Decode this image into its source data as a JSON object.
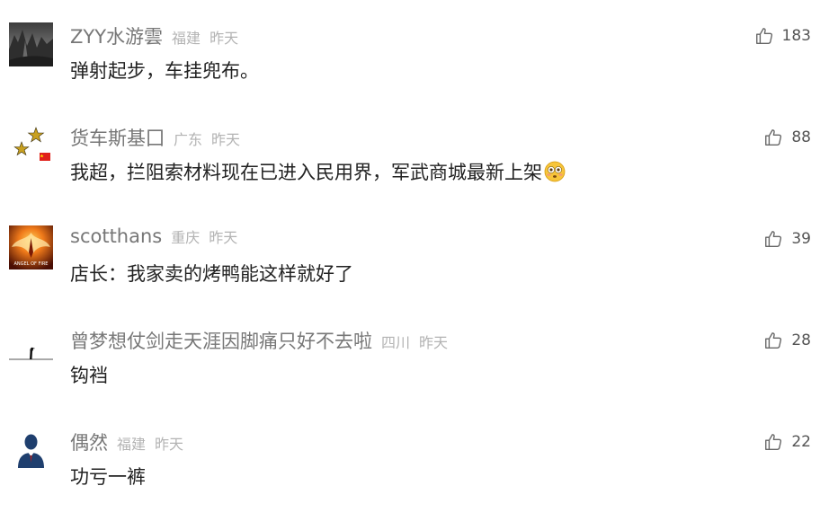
{
  "comments": [
    {
      "username": "ZYY水游雲",
      "region": "福建",
      "time": "昨天",
      "content": "弹射起步，车挂兜布。",
      "likes": "183",
      "avatar": "mountain-landscape-avatar"
    },
    {
      "username": "货车斯基囗",
      "region": "广东",
      "time": "昨天",
      "content": "我超，拦阻索材料现在已进入民用界，军武商城最新上架",
      "content_emoji": "flushed-face-emoji",
      "likes": "88",
      "avatar": "stars-flag-avatar"
    },
    {
      "username": "scotthans",
      "region": "重庆",
      "time": "昨天",
      "content": "店长：我家卖的烤鸭能这样就好了",
      "likes": "39",
      "avatar": "angel-of-fire-avatar",
      "avatar_text": "ANGEL OF FIRE"
    },
    {
      "username": "曾梦想仗剑走天涯因脚痛只好不去啦",
      "region": "四川",
      "time": "昨天",
      "content": "钩裆",
      "likes": "28",
      "avatar": "bird-silhouette-avatar"
    },
    {
      "username": "偶然",
      "region": "福建",
      "time": "昨天",
      "content": "功亏一裤",
      "likes": "22",
      "avatar": "default-person-avatar"
    }
  ],
  "icons": {
    "like": "thumbs-up-icon"
  },
  "colors": {
    "username": "#777777",
    "meta": "#b3b3b3",
    "content": "#222222",
    "like_count": "#555555"
  }
}
